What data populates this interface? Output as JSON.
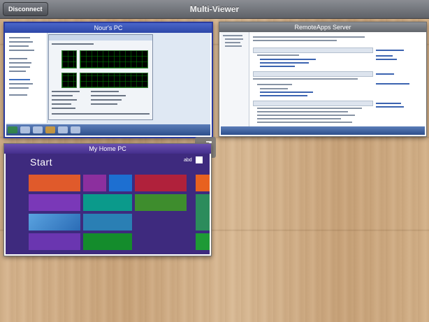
{
  "app": {
    "title": "Multi-Viewer",
    "disconnect_label": "Disconnect"
  },
  "sessions": [
    {
      "name": "Nour's PC",
      "accent": "#2d47a8"
    },
    {
      "name": "RemoteApps Server",
      "accent": "#6f7379"
    },
    {
      "name": "My Home PC",
      "accent": "#442f8c",
      "start_screen": {
        "heading": "Start"
      }
    }
  ],
  "colors": {
    "wood_background": "#cfab84",
    "topbar": "#6e7177",
    "windows_start": "#3e2a7e"
  },
  "icons": {
    "expand": "expand-window-icon"
  }
}
